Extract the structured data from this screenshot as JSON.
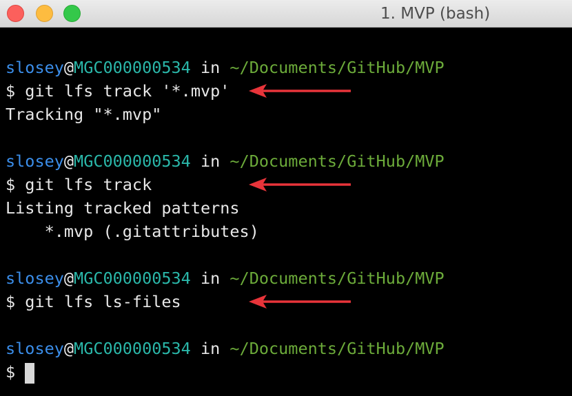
{
  "window": {
    "title": "1. MVP (bash)"
  },
  "prompt": {
    "user": "slosey",
    "at": "@",
    "host": "MGC000000534",
    "in": " in ",
    "path": "~/Documents/GitHub/MVP",
    "symbol": "$"
  },
  "lines": {
    "cmd1": "$ git lfs track '*.mvp'",
    "out1": "Tracking \"*.mvp\"",
    "cmd2": "$ git lfs track",
    "out2a": "Listing tracked patterns",
    "out2b": "    *.mvp (.gitattributes)",
    "cmd3": "$ git lfs ls-files",
    "cmd4": "$"
  },
  "colors": {
    "user": "#3b8eea",
    "host": "#2ab7a9",
    "path": "#6cab3a",
    "arrow": "#e8343a",
    "background": "#000000"
  },
  "annotations": {
    "arrow_icon": "red-left-arrow-icon"
  }
}
